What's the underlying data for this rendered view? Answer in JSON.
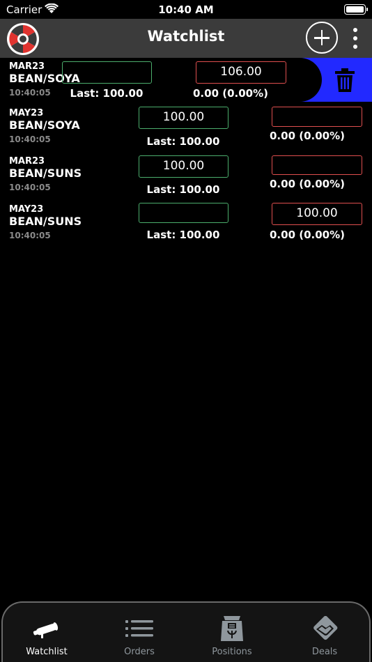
{
  "status_bar": {
    "carrier": "Carrier",
    "time": "10:40 AM"
  },
  "header": {
    "title": "Watchlist"
  },
  "rows": [
    {
      "month": "MAR23",
      "symbol": "BEAN/SOYA",
      "time": "10:40:05",
      "bid": "",
      "ask": "106.00",
      "last": "Last: 100.00",
      "change": "0.00 (0.00%)"
    },
    {
      "month": "MAY23",
      "symbol": "BEAN/SOYA",
      "time": "10:40:05",
      "bid": "100.00",
      "ask": "",
      "last": "Last: 100.00",
      "change": "0.00 (0.00%)"
    },
    {
      "month": "MAR23",
      "symbol": "BEAN/SUNS",
      "time": "10:40:05",
      "bid": "100.00",
      "ask": "",
      "last": "Last: 100.00",
      "change": "0.00 (0.00%)"
    },
    {
      "month": "MAY23",
      "symbol": "BEAN/SUNS",
      "time": "10:40:05",
      "bid": "",
      "ask": "100.00",
      "last": "Last: 100.00",
      "change": "0.00 (0.00%)"
    }
  ],
  "tabs": [
    {
      "label": "Watchlist",
      "icon": "telescope-icon",
      "active": true
    },
    {
      "label": "Orders",
      "icon": "list-icon",
      "active": false
    },
    {
      "label": "Positions",
      "icon": "sack-icon",
      "active": false
    },
    {
      "label": "Deals",
      "icon": "handshake-icon",
      "active": false
    }
  ],
  "colors": {
    "bid_border": "#4cae6d",
    "ask_border": "#e04f4f",
    "delete_bg": "#2229ff",
    "header_bg": "#3b3b3b",
    "active_tab": "#ffffff",
    "inactive_tab": "#8f979d"
  }
}
